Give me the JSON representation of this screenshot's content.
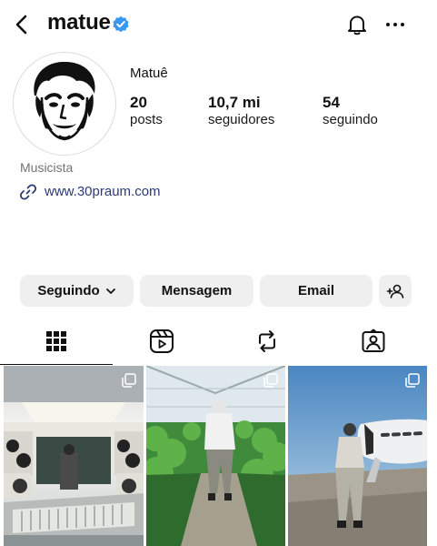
{
  "header": {
    "username": "matue",
    "icons": [
      "back-icon",
      "verified-icon",
      "bell-icon",
      "more-icon"
    ]
  },
  "profile": {
    "display_name": "Matuê",
    "stats": [
      {
        "value": "20",
        "label": "posts"
      },
      {
        "value": "10,7 mi",
        "label": "seguidores"
      },
      {
        "value": "54",
        "label": "seguindo"
      }
    ],
    "category": "Musicista",
    "link": "www.30praum.com"
  },
  "actions": {
    "following_label": "Seguindo",
    "message_label": "Mensagem",
    "email_label": "Email"
  },
  "tabs": [
    "grid-icon",
    "reels-icon",
    "reposts-icon",
    "tagged-icon"
  ],
  "colors": {
    "verified": "#3897f0",
    "link": "#2b3a78",
    "button_bg": "#efefef",
    "muted_text": "#737373"
  }
}
